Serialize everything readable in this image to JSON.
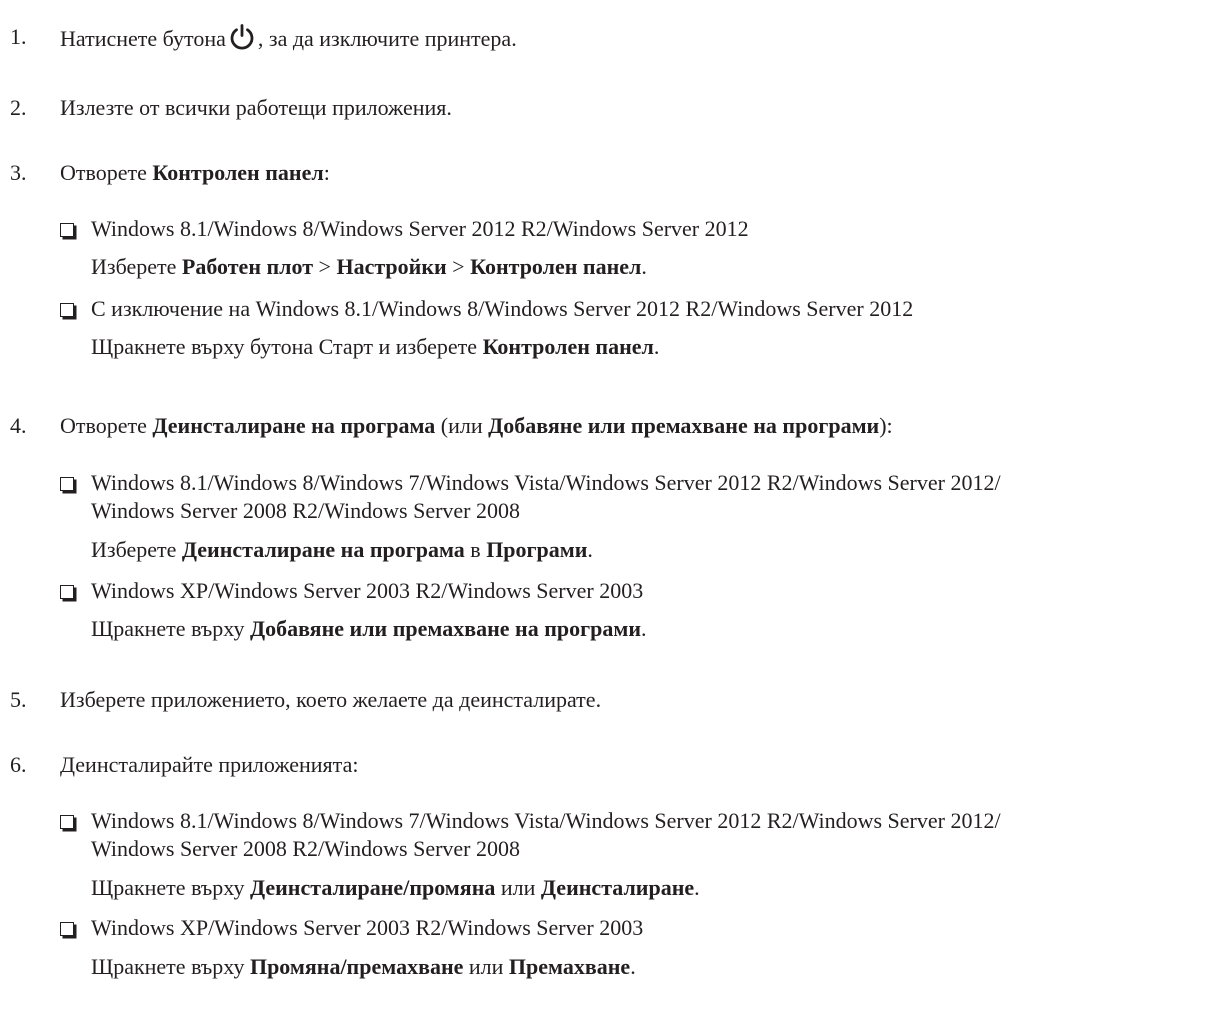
{
  "steps": [
    {
      "num": "1.",
      "pre": "Натиснете бутона",
      "post": ", за да изключите принтера."
    },
    {
      "num": "2.",
      "text": "Излезте от всички работещи приложения."
    },
    {
      "num": "3.",
      "pre": "Отворете ",
      "b1": "Контролен панел",
      "post": ":"
    },
    {
      "num": "4.",
      "pre": "Отворете ",
      "b1": "Деинсталиране на програма",
      "mid": " (или ",
      "b2": "Добавяне или премахване на програми",
      "post": "):"
    },
    {
      "num": "5.",
      "text": "Изберете приложението, което желаете да деинсталирате."
    },
    {
      "num": "6.",
      "text": "Деинсталирайте приложенията:"
    }
  ],
  "s3": {
    "o1": {
      "cond": "Windows 8.1/Windows 8/Windows Server 2012 R2/Windows Server 2012",
      "pre": "Изберете ",
      "b1": "Работен плот",
      "sep1": " > ",
      "b2": "Настройки",
      "sep2": " > ",
      "b3": "Контролен панел",
      "post": "."
    },
    "o2": {
      "cond": "С изключение на Windows 8.1/Windows 8/Windows Server 2012 R2/Windows Server 2012",
      "pre": "Щракнете върху бутона Старт и изберете ",
      "b1": "Контролен панел",
      "post": "."
    }
  },
  "s4": {
    "o1": {
      "cond1": "Windows 8.1/Windows 8/Windows 7/Windows Vista/Windows Server 2012 R2/Windows Server 2012/",
      "cond2": "Windows Server 2008 R2/Windows Server 2008",
      "pre": "Изберете ",
      "b1": "Деинсталиране на програма",
      "mid": " в ",
      "b2": "Програми",
      "post": "."
    },
    "o2": {
      "cond": "Windows XP/Windows Server 2003 R2/Windows Server 2003",
      "pre": "Щракнете върху ",
      "b1": "Добавяне или премахване на програми",
      "post": "."
    }
  },
  "s6": {
    "o1": {
      "cond1": "Windows 8.1/Windows 8/Windows 7/Windows Vista/Windows Server 2012 R2/Windows Server 2012/",
      "cond2": "Windows Server 2008 R2/Windows Server 2008",
      "pre": "Щракнете върху ",
      "b1": "Деинсталиране/промяна",
      "mid": " или ",
      "b2": "Деинсталиране",
      "post": "."
    },
    "o2": {
      "cond": "Windows XP/Windows Server 2003 R2/Windows Server 2003",
      "pre": "Щракнете върху ",
      "b1": "Промяна/премахване",
      "mid": " или ",
      "b2": "Премахване",
      "post": "."
    }
  },
  "icons": {
    "power": "power-icon"
  }
}
